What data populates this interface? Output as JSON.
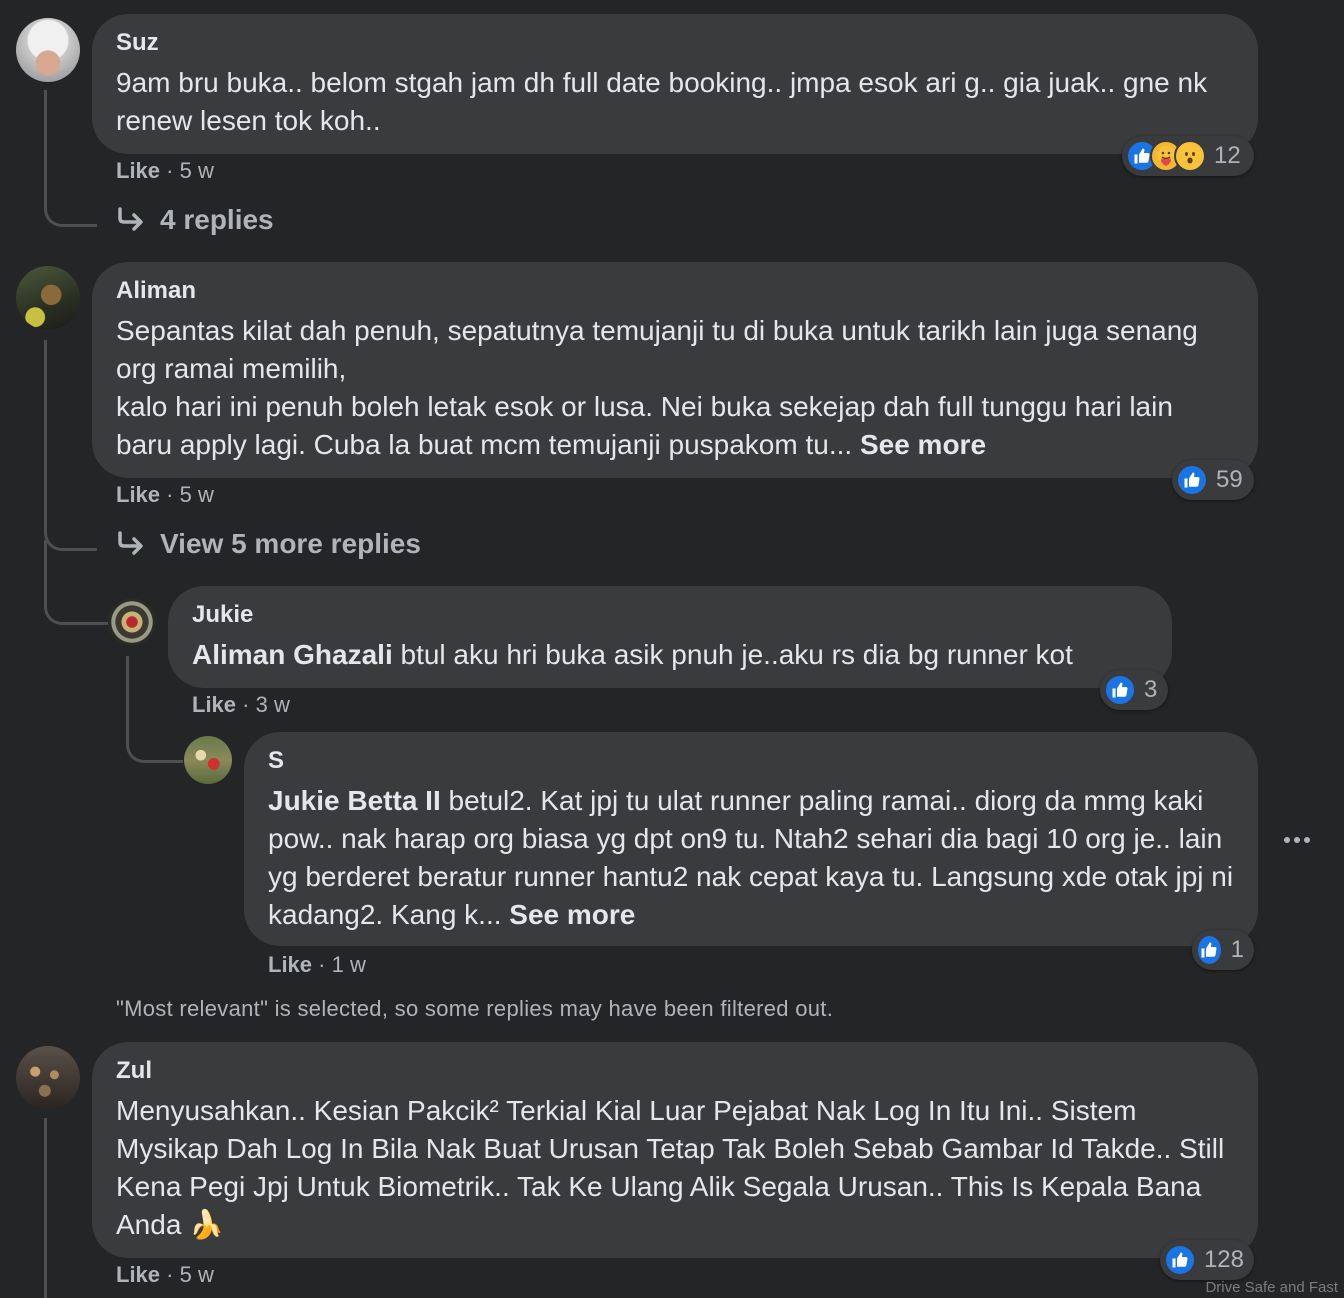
{
  "comments": [
    {
      "name": "Suz",
      "text": "9am bru buka.. belom stgah jam dh full date booking.. jmpa esok ari g.. gia juak.. gne nk renew lesen tok koh..",
      "like_label": "Like",
      "time": "5 w",
      "reaction_count": "12",
      "reactions": [
        "like-icon",
        "care-icon",
        "wow-icon"
      ],
      "replies_link": "4 replies"
    },
    {
      "name": "Aliman",
      "text": "Sepantas kilat dah penuh, sepatutnya temujanji tu di buka untuk tarikh lain juga senang org ramai memilih,\nkalo hari ini penuh boleh letak esok or lusa. Nei buka sekejap dah full tunggu hari lain baru apply lagi. Cuba la buat mcm temujanji puspakom tu...",
      "see_more": "See more",
      "like_label": "Like",
      "time": "5 w",
      "reaction_count": "59",
      "replies_link": "View 5 more replies",
      "replies": [
        {
          "name": "Jukie",
          "tag": "Aliman Ghazali",
          "text": " btul aku hri buka asik pnuh je..aku rs dia bg runner kot",
          "like_label": "Like",
          "time": "3 w",
          "reaction_count": "3"
        },
        {
          "name": "S",
          "tag": "Jukie Betta II",
          "text": " betul2. Kat jpj tu ulat runner paling ramai.. diorg da mmg kaki pow.. nak harap org biasa yg dpt on9 tu. Ntah2 sehari dia bagi 10 org je.. lain yg berderet beratur runner hantu2 nak cepat kaya tu. Langsung xde otak jpj ni kadang2. Kang k...",
          "see_more": "See more",
          "like_label": "Like",
          "time": "1 w",
          "reaction_count": "1"
        }
      ]
    },
    {
      "name": "Zul",
      "text": "Menyusahkan.. Kesian Pakcik² Terkial Kial Luar Pejabat Nak Log In Itu Ini.. Sistem Mysikap Dah Log In Bila Nak Buat Urusan Tetap Tak Boleh Sebab Gambar Id Takde.. Still Kena Pegi Jpj Untuk Biometrik.. Tak Ke Ulang Alik Segala Urusan.. This Is Kepala Bana Anda",
      "emoji": "🍌",
      "like_label": "Like",
      "time": "5 w",
      "reaction_count": "128"
    }
  ],
  "filter_notice": "\"Most relevant\" is selected, so some replies may have been filtered out.",
  "more_options": "more-options-icon",
  "watermark": "Drive Safe and Fast",
  "colors": {
    "background": "#242526",
    "bubble": "#3a3b3c",
    "text": "#e4e6eb",
    "secondary": "#b0b3b8",
    "like_blue": "#1b74e4"
  }
}
